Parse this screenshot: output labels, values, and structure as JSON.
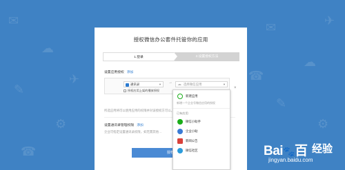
{
  "dialog": {
    "title": "授权微信办公套件托管你的应用",
    "steps": [
      "1.登录",
      "2.设置授权方法"
    ]
  },
  "section_app": {
    "label": "设置应用授权",
    "add": "添加"
  },
  "app_row": {
    "selected_app": "通讯录",
    "target_placeholder": "选择微信应用",
    "checkbox_label": "授权应用上架的播放授权",
    "close": "×"
  },
  "hint1": "所选应用将可以使用应用的权限并对该授权方可以。",
  "section_admin": {
    "label": "设置通讯录管理权限",
    "add": "添加"
  },
  "hint2": "企业可指定设置通讯录权限，如无需其他…",
  "confirm_button": "授权",
  "dropdown": {
    "search_placeholder": "搜索应用",
    "new_item": {
      "label": "新建应用",
      "desc": "新增一个企业号微信应用的授权"
    },
    "section_title": "已有应用",
    "items": [
      {
        "label": "微信小助手",
        "color": "#1aad19"
      },
      {
        "label": "企业小助",
        "color": "#3a7bd5"
      },
      {
        "label": "新闻公告",
        "color": "#d9413a"
      },
      {
        "label": "微信社区",
        "color": "#2c9cdb"
      }
    ]
  },
  "watermark": {
    "logo": "Bai",
    "logo_tail": "百",
    "brand_cn": "经验",
    "url": "jingyan.baidu.com"
  }
}
